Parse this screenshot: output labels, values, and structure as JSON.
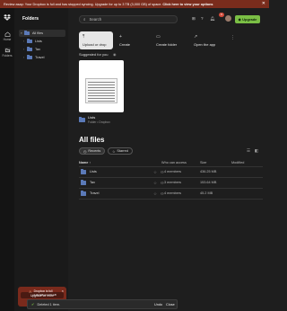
{
  "banner": {
    "text": "Review asap: Your Dropbox is full and has stopped syncing. Upgrade for up to 3 TB (3,000 GB) of space.",
    "link": "Click here to view your options",
    "close": "✕"
  },
  "rail": {
    "logo": "dropbox-logo",
    "items": [
      {
        "label": "Home",
        "icon": "home-icon"
      },
      {
        "label": "Folders",
        "icon": "folders-icon"
      }
    ]
  },
  "sidebar": {
    "title": "Folders",
    "tree": [
      {
        "label": "All files",
        "chevron": "▾"
      },
      {
        "label": "Lists",
        "chevron": "›"
      },
      {
        "label": "Tax",
        "chevron": "›"
      },
      {
        "label": "Travel",
        "chevron": "›"
      }
    ]
  },
  "storage": {
    "title": "Dropbox is full",
    "subtitle": "0.00 GB of 2.00 GB",
    "button": "Upgrade for more"
  },
  "header": {
    "search_placeholder": "Search",
    "notifications_count": "9",
    "upgrade_label": "Upgrade"
  },
  "actions": [
    {
      "label": "Upload or drop",
      "icon": "upload-icon",
      "glyph": "⤒"
    },
    {
      "label": "Create",
      "icon": "plus-icon",
      "glyph": "+"
    },
    {
      "label": "Create folder",
      "icon": "folder-plus-icon",
      "glyph": "▭"
    },
    {
      "label": "Open the app",
      "icon": "external-icon",
      "glyph": "↗"
    }
  ],
  "suggested": {
    "title": "Suggested for you",
    "card_name": "Lists",
    "card_sub": "Folder • Dropbox"
  },
  "files": {
    "heading": "All files",
    "chips": [
      "Recents",
      "Starred"
    ],
    "columns": {
      "name": "Name",
      "access": "Who can access",
      "size": "Size",
      "modified": "Modified"
    },
    "sort_arrow": "↑",
    "rows": [
      {
        "name": "Lists",
        "access": "4 members",
        "size": "436.25 MB"
      },
      {
        "name": "Tax",
        "access": "3 members",
        "size": "153.64 MB"
      },
      {
        "name": "Travel",
        "access": "4 members",
        "size": "45.2 MB"
      }
    ]
  },
  "toast": {
    "text": "Deleted 1 item.",
    "undo": "Undo",
    "close": "Close"
  },
  "colors": {
    "banner_bg": "#7a2c1c",
    "upgrade_green": "#7bbf45",
    "folder_blue": "#5b7ab8",
    "page_bg": "#1e1e1e"
  }
}
